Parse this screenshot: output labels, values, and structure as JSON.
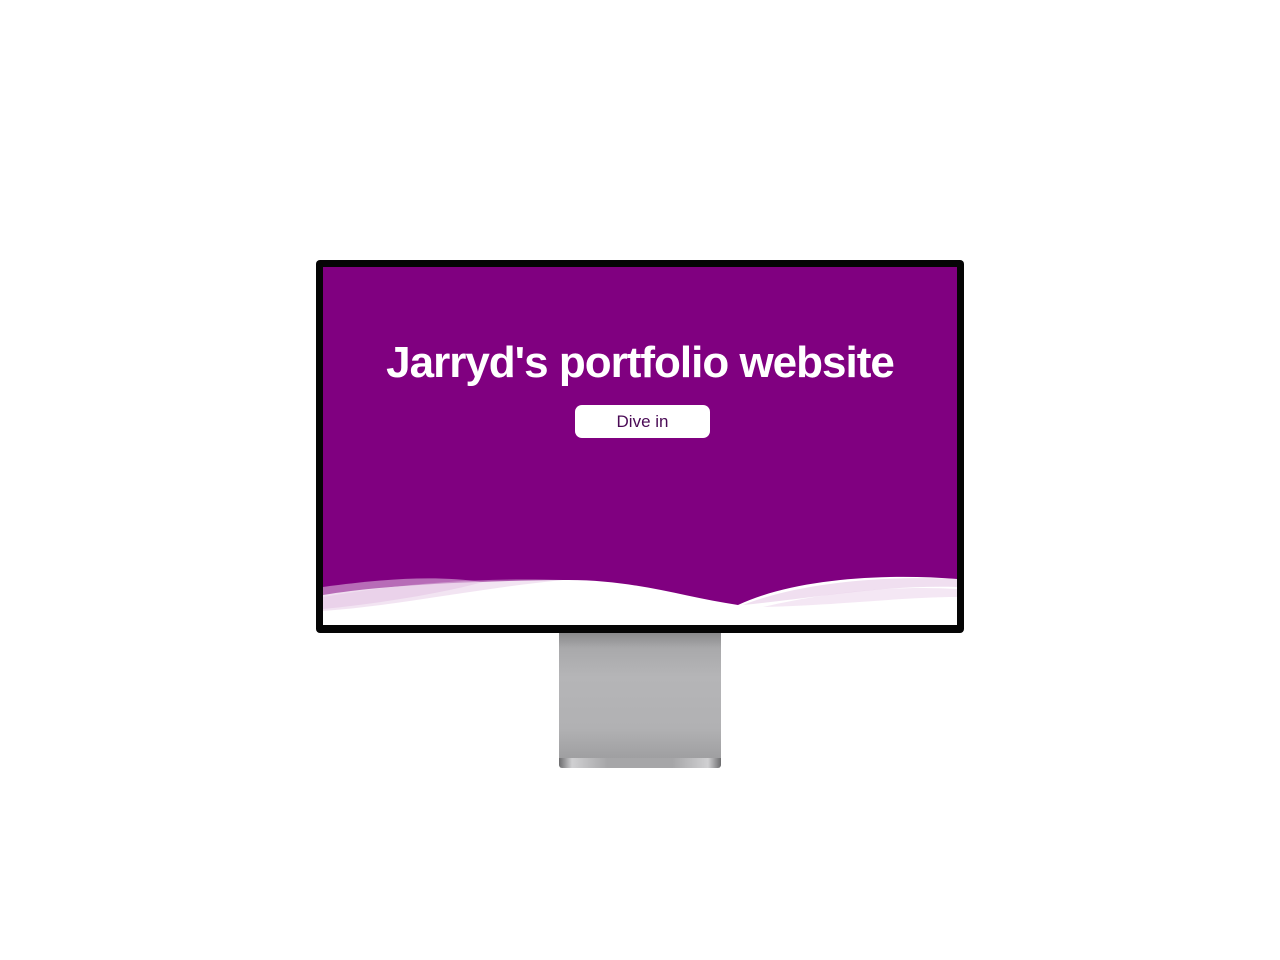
{
  "page": {
    "background_color": "#ffffff"
  },
  "monitor": {
    "bezel_color": "#050505",
    "stand_color": "#b3b3b5"
  },
  "website": {
    "background_color": "#800080",
    "wave_color": "#e3c4e3",
    "hero": {
      "title": "Jarryd's portfolio website",
      "button_label": "Dive in"
    }
  }
}
